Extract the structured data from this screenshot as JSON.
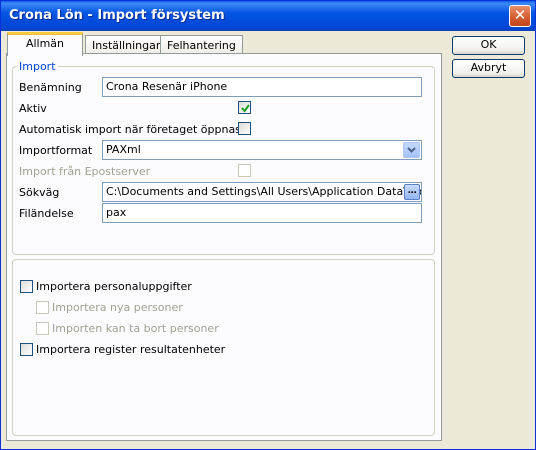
{
  "window": {
    "title": "Crona Lön - Import försystem",
    "close_label": "✕"
  },
  "tabs": [
    {
      "label": "Allmän",
      "active": true
    },
    {
      "label": "Inställningar",
      "active": false
    },
    {
      "label": "Felhantering",
      "active": false
    }
  ],
  "buttons": {
    "ok": "OK",
    "cancel": "Avbryt"
  },
  "import_group": {
    "legend": "Import",
    "name_label": "Benämning",
    "name_value": "Crona Resenär iPhone",
    "active_label": "Aktiv",
    "active_checked": true,
    "auto_import_label": "Automatisk import när företaget öppnas",
    "auto_import_checked": false,
    "format_label": "Importformat",
    "format_value": "PAXml",
    "email_import_label": "Import från Epostserver",
    "email_import_checked": false,
    "path_label": "Sökväg",
    "path_value": "C:\\Documents and Settings\\All Users\\Application Data\\Crona\\C",
    "browse_label": "...",
    "extension_label": "Filändelse",
    "extension_value": "pax"
  },
  "options_group": {
    "import_personal_label": "Importera personaluppgifter",
    "import_personal_checked": false,
    "import_new_label": "Importera nya personer",
    "import_new_checked": false,
    "import_delete_label": "Importen kan ta bort personer",
    "import_delete_checked": false,
    "import_register_label": "Importera register resultatenheter",
    "import_register_checked": false
  },
  "colors": {
    "titlebar": "#0554E3",
    "accent_tab": "#FFC83C",
    "legend": "#0046D5",
    "check": "#21A121"
  }
}
